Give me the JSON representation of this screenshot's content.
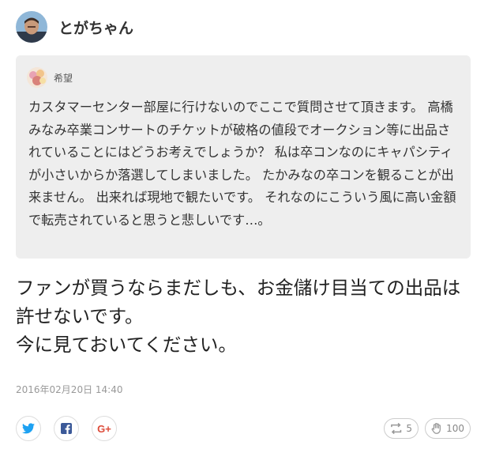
{
  "post": {
    "author": {
      "name": "とがちゃん",
      "avatar_icon": "user-avatar"
    },
    "quote": {
      "author_name": "希望",
      "avatar_icon": "quoted-user-avatar",
      "text": "カスタマーセンター部屋に行けないのでここで質問させて頂きます。 高橋みなみ卒業コンサートのチケットが破格の値段でオークション等に出品されていることにはどうお考えでしょうか？ 私は卒コンなのにキャパシティが小さいからか落選してしまいました。 たかみなの卒コンを観ることが出来ません。 出来れば現地で観たいです。 それなのにこういう風に高い金額で転売されていると思うと悲しいです…。"
    },
    "body_lines": [
      "ファンが買うならまだしも、お金儲け目当ての出品は許せないです。",
      "今に見ておいてください。"
    ],
    "timestamp": "2016年02月20日 14:40"
  },
  "share": {
    "twitter_icon": "twitter-icon",
    "facebook_icon": "facebook-icon",
    "googleplus_label": "G+"
  },
  "reactions": {
    "repost_count": "5",
    "like_count": "100"
  },
  "colors": {
    "twitter": "#1da1f2",
    "facebook": "#3b5998",
    "googleplus": "#dd4b39",
    "quote_bg": "#eeeeee"
  }
}
